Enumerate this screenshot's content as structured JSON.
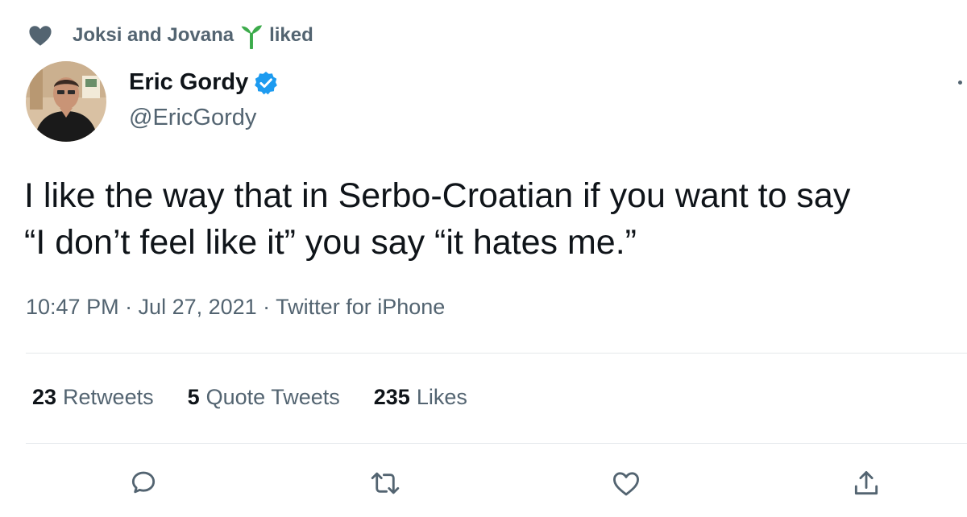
{
  "social_context": {
    "names": "Joksi and Jovana",
    "action": "liked"
  },
  "author": {
    "name": "Eric Gordy",
    "handle": "@EricGordy",
    "verified": true
  },
  "tweet": {
    "text": "I like the way that in Serbo-Croatian if you want to say\n“I don’t feel like it” you say “it hates me.”",
    "meta": "10:47 PM · Jul 27, 2021 · Twitter for iPhone"
  },
  "stats": {
    "retweets_count": "23",
    "retweets_label": "Retweets",
    "quotes_count": "5",
    "quotes_label": "Quote Tweets",
    "likes_count": "235",
    "likes_label": "Likes"
  },
  "actions": [
    "reply-icon",
    "retweet-icon",
    "like-icon",
    "share-icon"
  ],
  "colors": {
    "primary_text": "#0f1419",
    "secondary_text": "#536471",
    "verified_blue": "#1d9bf0",
    "sprout_green": "#3cab4b",
    "divider": "#e4e8eb"
  }
}
